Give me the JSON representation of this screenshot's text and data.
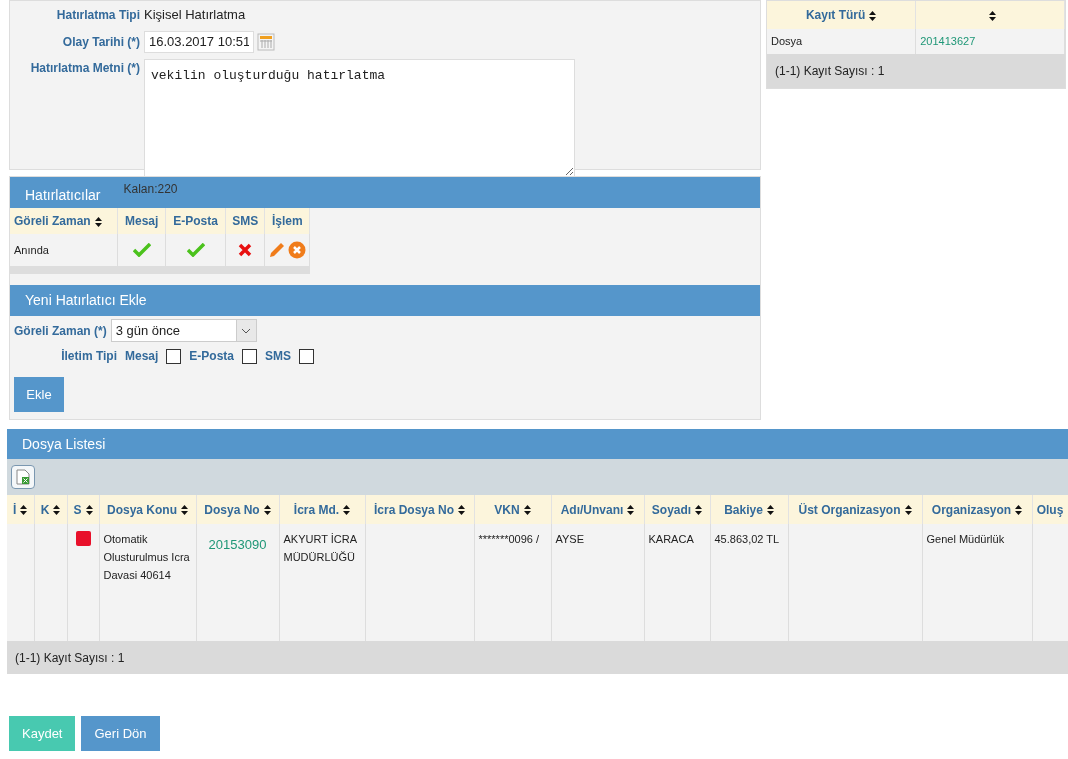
{
  "reminder_form": {
    "type_label": "Hatırlatma Tipi",
    "type_value": "Kişisel Hatırlatma",
    "date_label": "Olay Tarihi (*)",
    "date_value": "16.03.2017 10:51",
    "text_label": "Hatırlatma Metni (*)",
    "text_value": "vekilin oluşturduğu hatırlatma"
  },
  "record_table": {
    "columns": [
      {
        "label": "Kayıt Türü",
        "sortable": true
      },
      {
        "sortable": true
      }
    ],
    "rows": [
      {
        "cells": [
          "Dosya",
          "201413627"
        ]
      }
    ],
    "footer": "(1-1) Kayıt Sayısı : 1"
  },
  "reminders": {
    "title": "Hatırlatıcılar",
    "remaining": "Kalan:220",
    "columns": [
      {
        "label": "Göreli Zaman",
        "sortable": true
      },
      {
        "label": "Mesaj",
        "sortable": false
      },
      {
        "label": "E-Posta",
        "sortable": false
      },
      {
        "label": "SMS",
        "sortable": false
      },
      {
        "label": "İşlem",
        "sortable": false
      }
    ],
    "rows": [
      {
        "relative_time": "Anında",
        "message": true,
        "email": true,
        "sms": false
      }
    ]
  },
  "new_reminder": {
    "title": "Yeni Hatırlatıcı Ekle",
    "relative_time_label": "Göreli Zaman (*)",
    "relative_time_value": "3 gün önce",
    "channel_label": "İletim Tipi",
    "channels": [
      {
        "label": "Mesaj",
        "checked": false
      },
      {
        "label": "E-Posta",
        "checked": false
      },
      {
        "label": "SMS",
        "checked": false
      }
    ],
    "add_button": "Ekle"
  },
  "file_list": {
    "title": "Dosya Listesi",
    "columns": [
      {
        "label": "İ",
        "sortable": true
      },
      {
        "label": "K",
        "sortable": true
      },
      {
        "label": "S",
        "sortable": true
      },
      {
        "label": "Dosya Konu",
        "sortable": true
      },
      {
        "label": "Dosya No",
        "sortable": true
      },
      {
        "label": "İcra Md.",
        "sortable": true
      },
      {
        "label": "İcra Dosya No",
        "sortable": true
      },
      {
        "label": "VKN",
        "sortable": true
      },
      {
        "label": "Adı/Unvanı",
        "sortable": true
      },
      {
        "label": "Soyadı",
        "sortable": true
      },
      {
        "label": "Bakiye",
        "sortable": true
      },
      {
        "label": "Üst Organizasyon",
        "sortable": true
      },
      {
        "label": "Organizasyon",
        "sortable": true
      },
      {
        "label": "Oluş",
        "sortable": false
      }
    ],
    "rows": [
      {
        "color": "#e8102a",
        "cells": [
          null,
          null,
          null,
          "Otomatik Olusturulmus Icra Davasi 40614",
          "20153090",
          "AKYURT İCRA MÜDÜRLÜĞÜ",
          null,
          "*******0096 /",
          "AYSE",
          "KARACA",
          "45.863,02 TL",
          null,
          "Genel Müdürlük",
          null
        ]
      }
    ],
    "footer": "(1-1) Kayıt Sayısı : 1"
  },
  "buttons": [
    {
      "label": "Kaydet",
      "kind": "save"
    },
    {
      "label": "Geri Dön",
      "kind": "back"
    }
  ]
}
